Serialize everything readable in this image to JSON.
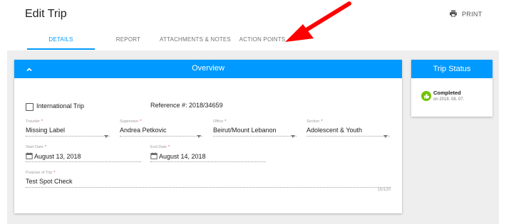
{
  "page": {
    "title": "Edit Trip",
    "print_label": "PRINT"
  },
  "tabs": [
    {
      "label": "DETAILS",
      "active": true
    },
    {
      "label": "REPORT",
      "active": false
    },
    {
      "label": "ATTACHMENTS & NOTES",
      "active": false
    },
    {
      "label": "ACTION POINTS",
      "active": false
    }
  ],
  "overview": {
    "header": "Overview",
    "international_trip_label": "International Trip",
    "international_trip_checked": false,
    "reference": "Reference #: 2018/34659",
    "fields": {
      "traveler": {
        "label": "Traveler",
        "value": "Missing Label"
      },
      "supervisor": {
        "label": "Supervisor",
        "value": "Andrea Petkovic"
      },
      "office": {
        "label": "Office",
        "value": "Beirut/Mount Lebanon"
      },
      "section": {
        "label": "Section",
        "value": "Adolescent & Youth"
      },
      "start_date": {
        "label": "Start Date",
        "value": "August 13, 2018"
      },
      "end_date": {
        "label": "End Date",
        "value": "August 14, 2018"
      },
      "purpose": {
        "label": "Purpose of Trip",
        "value": "Test Spot Check"
      }
    },
    "char_counter": "15/120"
  },
  "trip_status": {
    "header": "Trip Status",
    "status": "Completed",
    "date": "on 2018. 08. 07."
  },
  "icons": {
    "print": "printer-icon",
    "collapse": "chevron-up-icon",
    "calendar": "calendar-icon",
    "dropdown": "caret-down-icon",
    "status": "thumbs-up-icon"
  },
  "colors": {
    "accent": "#0099ff",
    "required": "#e53935",
    "status_ok": "#72c300",
    "annotation": "#ff0000"
  }
}
